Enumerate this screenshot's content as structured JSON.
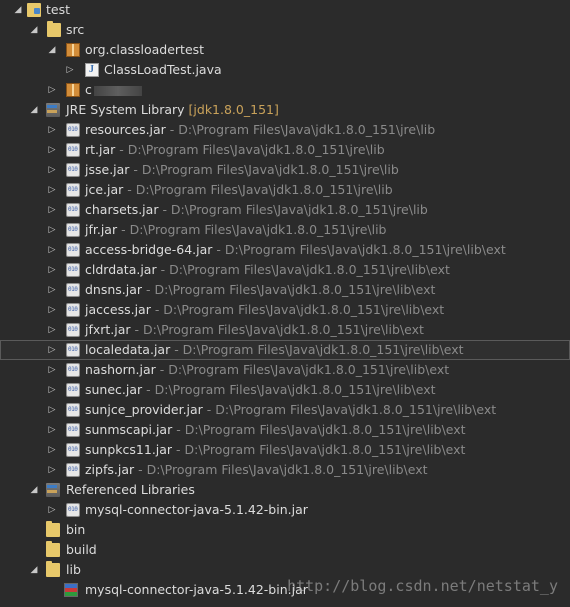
{
  "tree": {
    "project": {
      "label": "test"
    },
    "src": {
      "label": "src"
    },
    "package1": {
      "label": "org.classloadertest"
    },
    "classfile": {
      "label": "ClassLoadTest.java"
    },
    "package2": {
      "label": "c"
    },
    "jre": {
      "label": "JRE System Library",
      "decoration": "[jdk1.8.0_151]"
    },
    "jre_items": [
      {
        "name": "resources.jar",
        "path": " - D:\\Program Files\\Java\\jdk1.8.0_151\\jre\\lib"
      },
      {
        "name": "rt.jar",
        "path": " - D:\\Program Files\\Java\\jdk1.8.0_151\\jre\\lib"
      },
      {
        "name": "jsse.jar",
        "path": " - D:\\Program Files\\Java\\jdk1.8.0_151\\jre\\lib"
      },
      {
        "name": "jce.jar",
        "path": " - D:\\Program Files\\Java\\jdk1.8.0_151\\jre\\lib"
      },
      {
        "name": "charsets.jar",
        "path": " - D:\\Program Files\\Java\\jdk1.8.0_151\\jre\\lib"
      },
      {
        "name": "jfr.jar",
        "path": " - D:\\Program Files\\Java\\jdk1.8.0_151\\jre\\lib"
      },
      {
        "name": "access-bridge-64.jar",
        "path": " - D:\\Program Files\\Java\\jdk1.8.0_151\\jre\\lib\\ext"
      },
      {
        "name": "cldrdata.jar",
        "path": " - D:\\Program Files\\Java\\jdk1.8.0_151\\jre\\lib\\ext"
      },
      {
        "name": "dnsns.jar",
        "path": " - D:\\Program Files\\Java\\jdk1.8.0_151\\jre\\lib\\ext"
      },
      {
        "name": "jaccess.jar",
        "path": " - D:\\Program Files\\Java\\jdk1.8.0_151\\jre\\lib\\ext"
      },
      {
        "name": "jfxrt.jar",
        "path": " - D:\\Program Files\\Java\\jdk1.8.0_151\\jre\\lib\\ext"
      },
      {
        "name": "localedata.jar",
        "path": " - D:\\Program Files\\Java\\jdk1.8.0_151\\jre\\lib\\ext"
      },
      {
        "name": "nashorn.jar",
        "path": " - D:\\Program Files\\Java\\jdk1.8.0_151\\jre\\lib\\ext"
      },
      {
        "name": "sunec.jar",
        "path": " - D:\\Program Files\\Java\\jdk1.8.0_151\\jre\\lib\\ext"
      },
      {
        "name": "sunjce_provider.jar",
        "path": " - D:\\Program Files\\Java\\jdk1.8.0_151\\jre\\lib\\ext"
      },
      {
        "name": "sunmscapi.jar",
        "path": " - D:\\Program Files\\Java\\jdk1.8.0_151\\jre\\lib\\ext"
      },
      {
        "name": "sunpkcs11.jar",
        "path": " - D:\\Program Files\\Java\\jdk1.8.0_151\\jre\\lib\\ext"
      },
      {
        "name": "zipfs.jar",
        "path": " - D:\\Program Files\\Java\\jdk1.8.0_151\\jre\\lib\\ext"
      }
    ],
    "refs": {
      "label": "Referenced Libraries"
    },
    "refjar": {
      "label": "mysql-connector-java-5.1.42-bin.jar"
    },
    "bin": {
      "label": "bin"
    },
    "build": {
      "label": "build"
    },
    "lib": {
      "label": "lib"
    },
    "libjar": {
      "label": "mysql-connector-java-5.1.42-bin.jar"
    }
  },
  "watermark": "http://blog.csdn.net/netstat_y",
  "colors": {
    "background": "#2b2b2b",
    "text": "#dcdcdc",
    "path": "#8a8a8a",
    "decoration": "#c9a25a"
  }
}
